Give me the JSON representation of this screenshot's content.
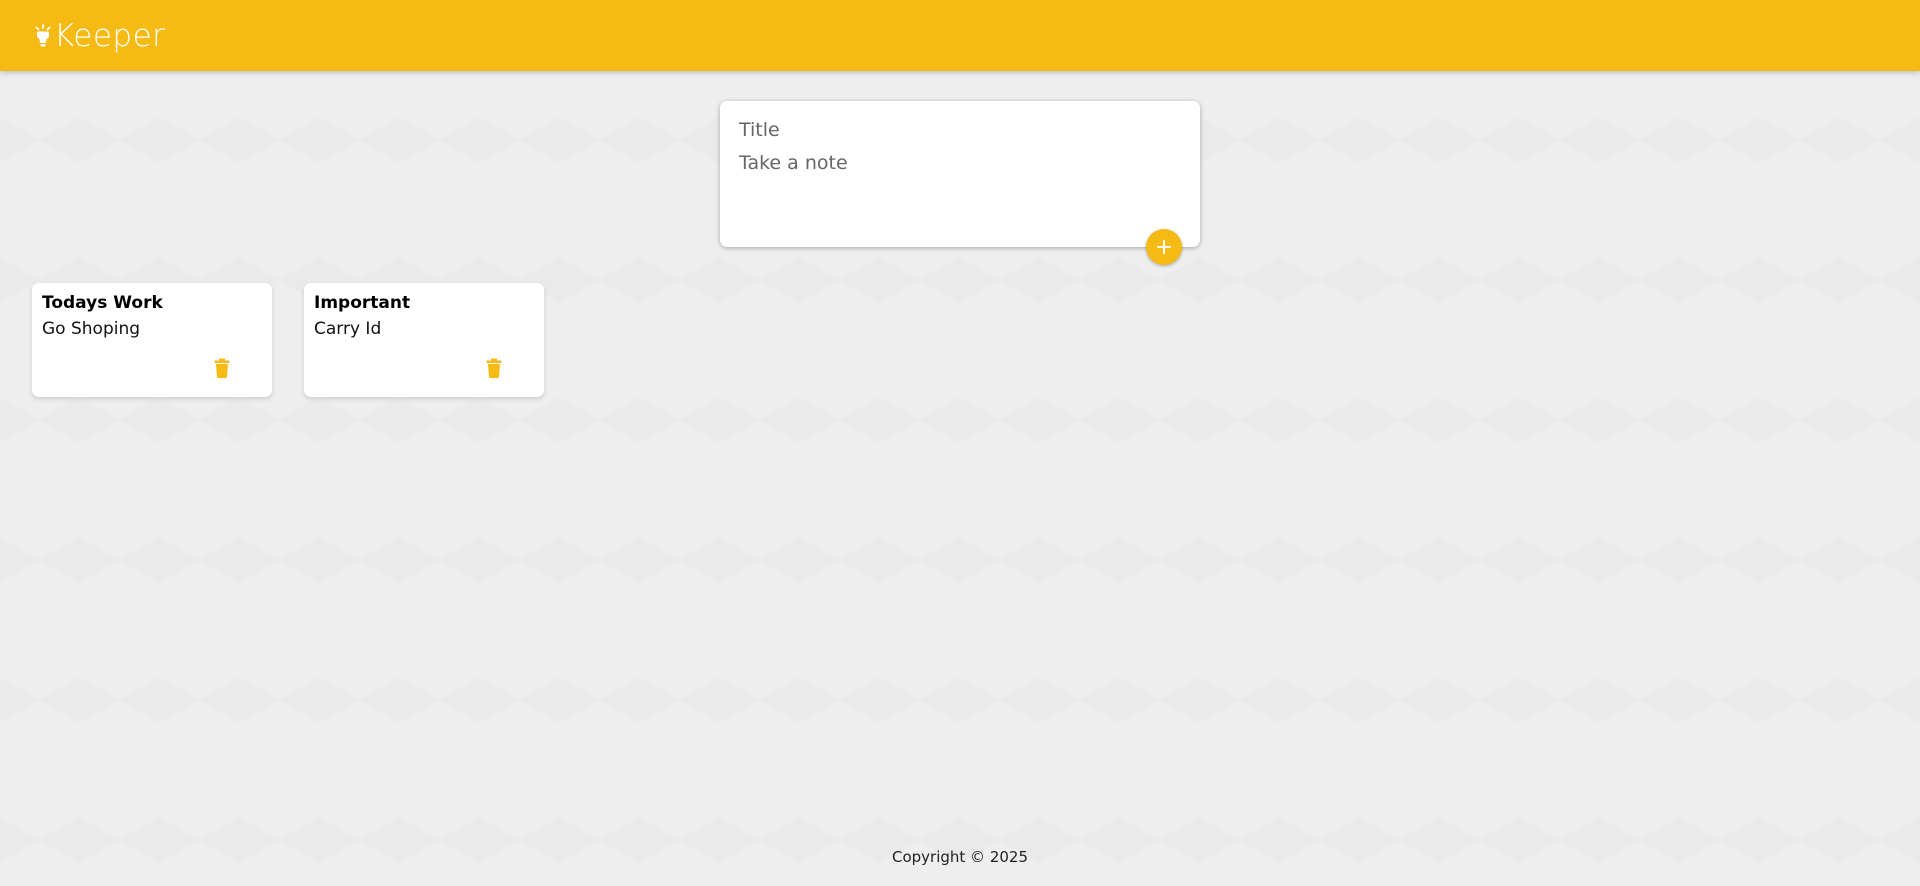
{
  "header": {
    "app_name": "Keeper",
    "logo_icon": "lightbulb-icon"
  },
  "create_note": {
    "title_placeholder": "Title",
    "content_placeholder": "Take a note",
    "add_icon": "plus-icon"
  },
  "notes": [
    {
      "title": "Todays Work",
      "content": "Go Shoping",
      "delete_icon": "trash-icon"
    },
    {
      "title": "Important",
      "content": "Carry Id",
      "delete_icon": "trash-icon"
    }
  ],
  "footer": {
    "copyright": "Copyright © 2025"
  },
  "colors": {
    "accent": "#f5ba13",
    "background": "#eeeeee",
    "card": "#ffffff"
  }
}
